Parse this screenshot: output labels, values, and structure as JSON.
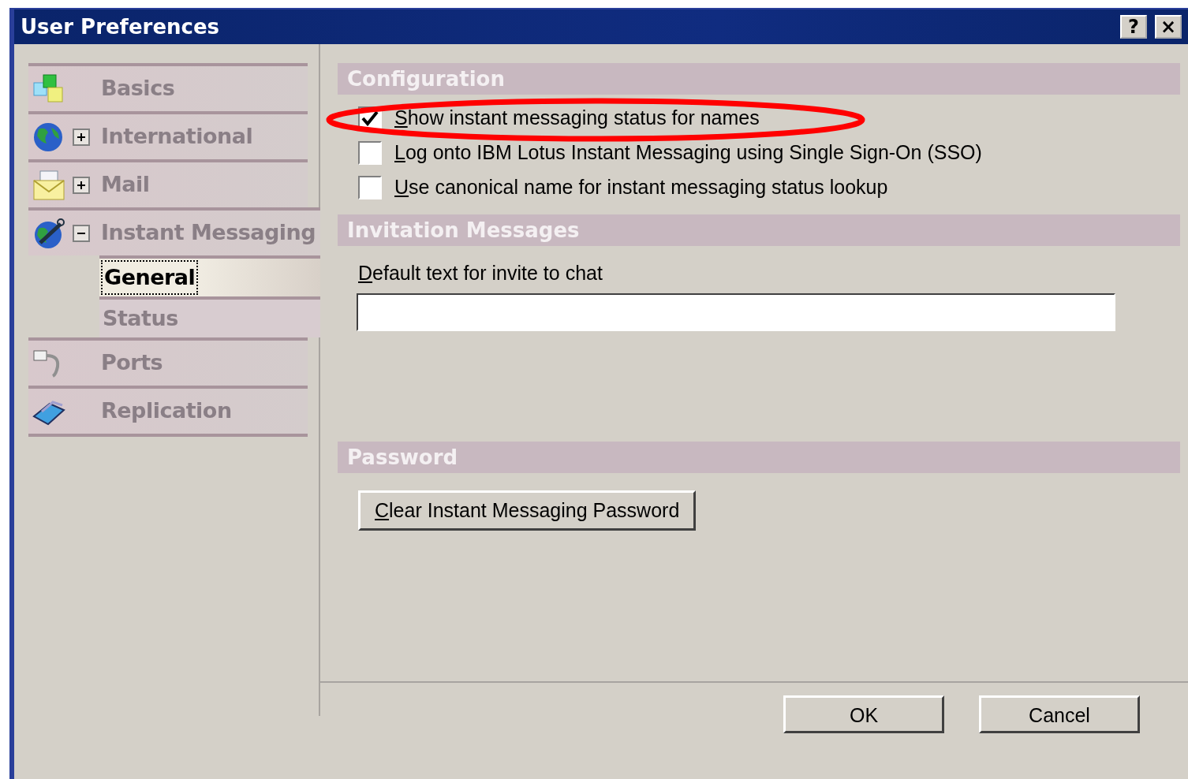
{
  "window": {
    "title": "User Preferences",
    "buttons": [
      "?",
      "×"
    ]
  },
  "sidebar": {
    "items": [
      {
        "kind": "page",
        "label": "Basics",
        "selected": false
      },
      {
        "kind": "group",
        "label": "International",
        "expanded": false,
        "selected": false
      },
      {
        "kind": "group",
        "label": "Mail",
        "expanded": false,
        "selected": false
      },
      {
        "kind": "group",
        "label": "Instant Messaging",
        "expanded": true,
        "selected": false,
        "children": [
          {
            "label": "General",
            "selected": true
          },
          {
            "label": "Status",
            "selected": false
          }
        ]
      },
      {
        "kind": "page",
        "label": "Ports",
        "selected": false
      },
      {
        "kind": "page",
        "label": "Replication",
        "selected": false
      }
    ]
  },
  "sections": [
    {
      "title": "Configuration",
      "options": [
        {
          "label": "Show instant messaging status for names",
          "checked": true
        },
        {
          "label": "Log onto IBM Lotus Instant Messaging using Single Sign-On (SSO)",
          "checked": false
        },
        {
          "label": "Use canonical name for instant messaging status lookup",
          "checked": false
        }
      ]
    },
    {
      "title": "Invitation Messages",
      "field": {
        "label": "Default text for invite to chat"
      }
    },
    {
      "title": "Password",
      "button": "Clear Instant Messaging Password"
    }
  ],
  "annotations": [
    {
      "kind": "ellipse"
    }
  ],
  "footer_buttons": [
    "OK",
    "Cancel"
  ]
}
